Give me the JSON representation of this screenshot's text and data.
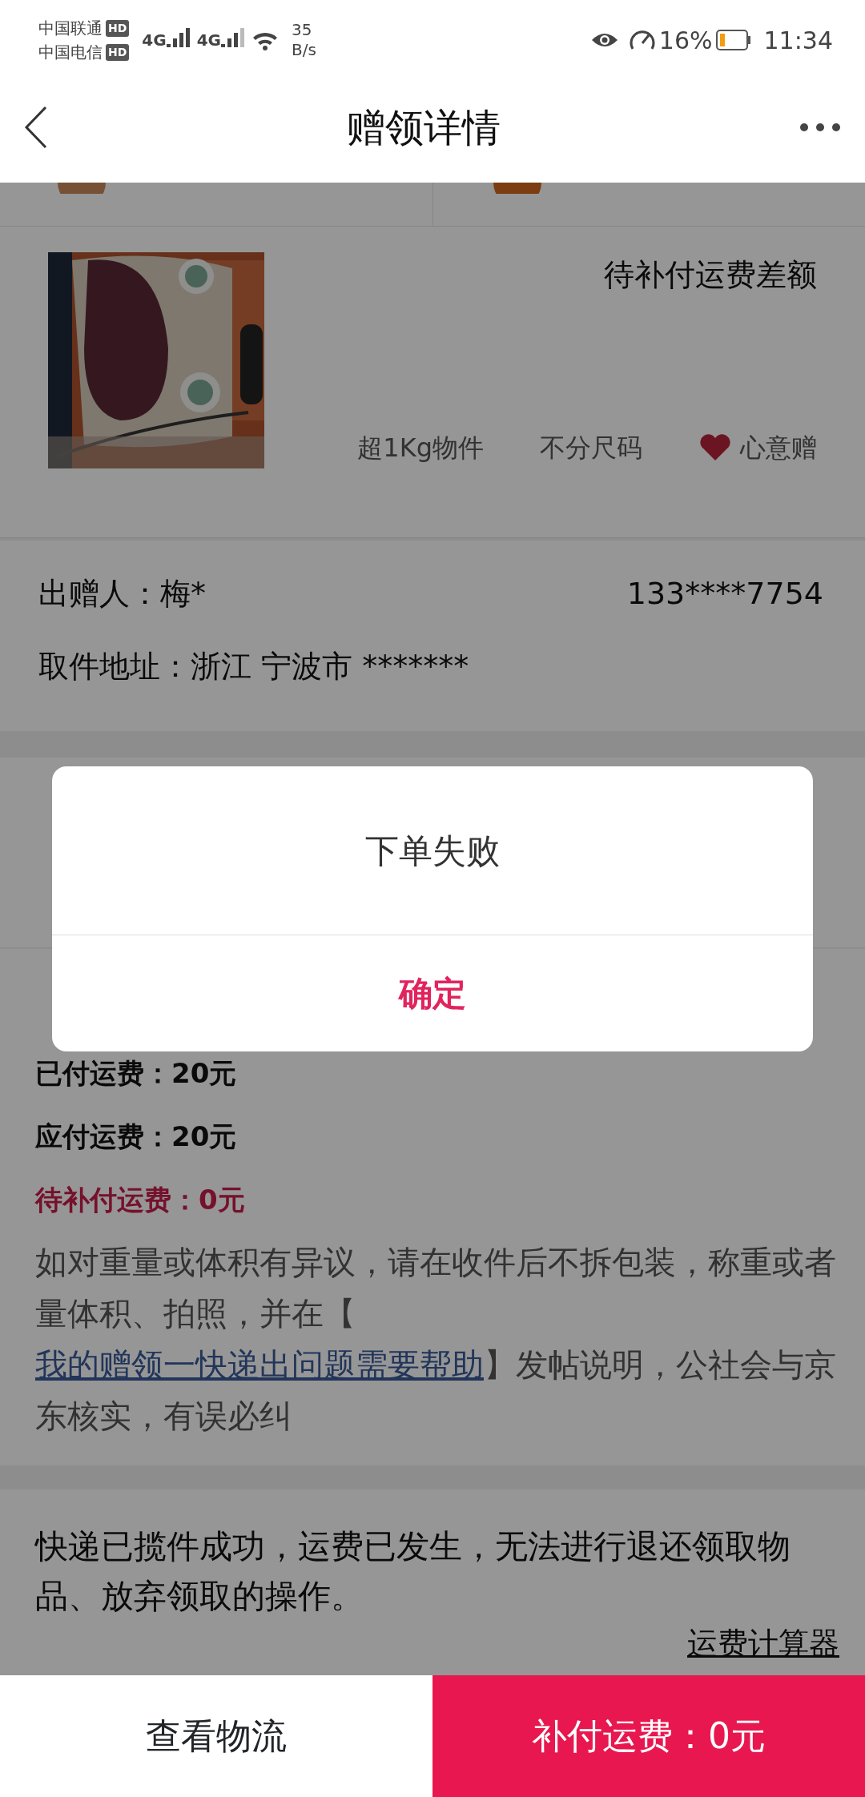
{
  "status_bar": {
    "carriers": [
      {
        "name": "中国联通",
        "badge": "HD"
      },
      {
        "name": "中国电信",
        "badge": "HD"
      }
    ],
    "networks": [
      "4G",
      "4G"
    ],
    "speed": [
      "35",
      "B/s"
    ],
    "battery": "16%",
    "time": "11:34"
  },
  "header": {
    "title": "赠领详情"
  },
  "product": {
    "kind": "picture",
    "status": "待补付运费差额",
    "tags": [
      {
        "label": "超1Kg物件",
        "kind": "plain"
      },
      {
        "label": "不分尺码",
        "kind": "plain"
      },
      {
        "label": "心意赠",
        "kind": "heart"
      }
    ]
  },
  "donor": {
    "name": "出赠人：梅*",
    "phone": "133****7754",
    "address": "取件地址：浙江 宁波市 *******"
  },
  "fee": {
    "paid": "已付运费：20元",
    "due": "应付运费：20元",
    "pending": "待补付运费：0元",
    "note_before": "如对重量或体积有异议，请在收件后不拆包装，称重或者量体积、拍照，并在【 ",
    "note_link": "我的赠领一快递出问题需要帮助",
    "note_after": "】发帖说明，公社会与京东核实，有误必纠"
  },
  "notice": {
    "text": "快递已揽件成功，运费已发生，无法进行退还领取物品、放弃领取的操作。",
    "link": "运费计算器"
  },
  "bottom_bar": [
    {
      "label": "查看物流",
      "kind": "secondary"
    },
    {
      "label": "补付运费：0元",
      "kind": "primary"
    }
  ],
  "dialog": {
    "message": "下单失败",
    "button": "确定"
  }
}
